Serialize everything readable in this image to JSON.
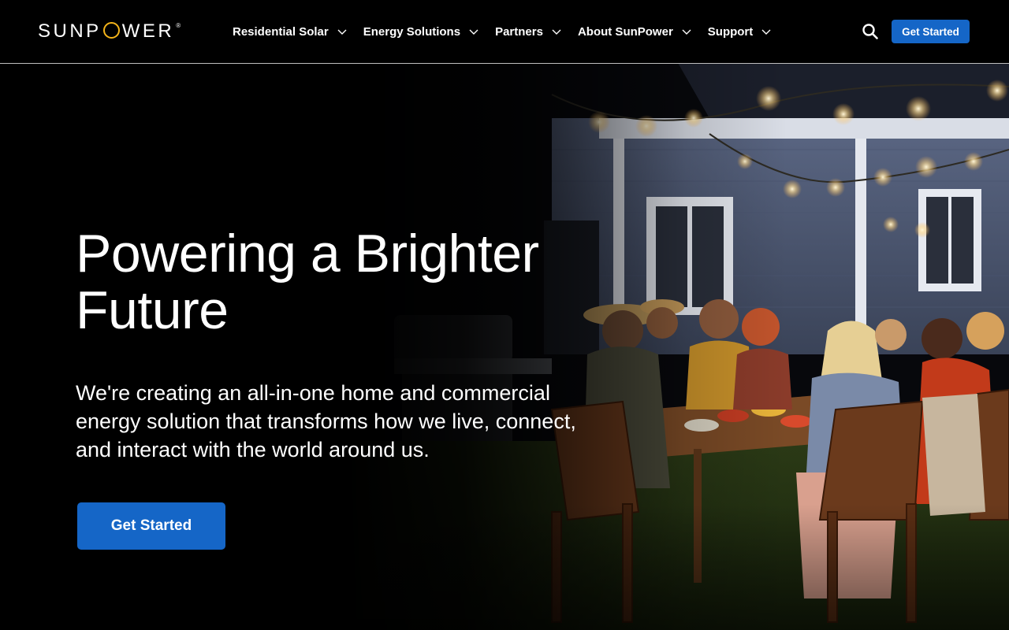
{
  "brand": {
    "name_left": "SUNP",
    "name_right": "WER",
    "registered_mark": "®",
    "accent_color": "#f4b41a"
  },
  "nav": {
    "items": [
      {
        "label": "Residential Solar"
      },
      {
        "label": "Energy Solutions"
      },
      {
        "label": "Partners"
      },
      {
        "label": "About SunPower"
      },
      {
        "label": "Support"
      }
    ],
    "search_icon": "search-icon",
    "cta_label": "Get Started"
  },
  "hero": {
    "title": "Powering a Brighter Future",
    "subtitle": "We're creating an all-in-one home and commercial energy solution that transforms how we live, connect, and interact with the world around us.",
    "cta_label": "Get Started",
    "image_description_icon": "photo-family-dinner-backyard"
  },
  "colors": {
    "primary_button": "#1566c7",
    "background": "#000000",
    "text": "#ffffff"
  }
}
